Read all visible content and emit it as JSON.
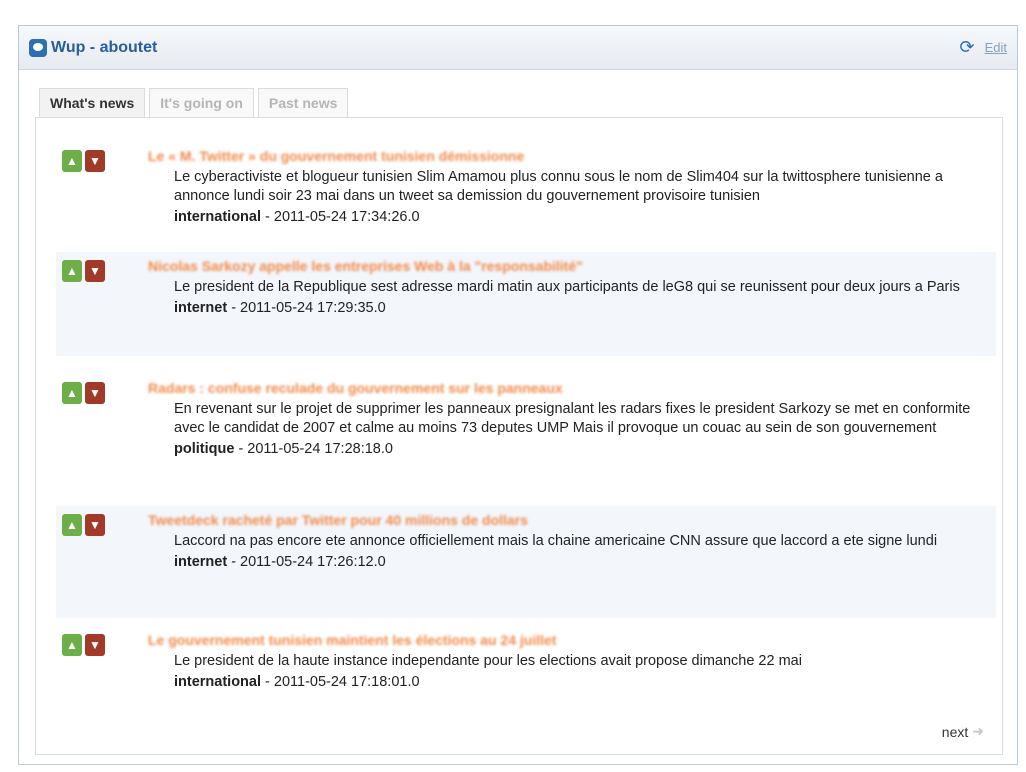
{
  "widget": {
    "title": "Wup - aboutet",
    "edit_label": "Edit"
  },
  "tabs": [
    {
      "label": "What's news"
    },
    {
      "label": "It's going on"
    },
    {
      "label": "Past news"
    }
  ],
  "news": [
    {
      "title": "Le « M. Twitter » du gouvernement tunisien démissionne",
      "body": "Le cyberactiviste et blogueur tunisien Slim Amamou plus connu sous le nom de Slim404 sur la twittosphere tunisienne a annonce lundi soir 23 mai dans un tweet sa demission du gouvernement provisoire tunisien",
      "category": "international",
      "timestamp": " - 2011-05-24 17:34:26.0"
    },
    {
      "title": "Nicolas Sarkozy appelle les entreprises Web à la \"responsabilité\"",
      "body": "Le president de la Republique sest adresse mardi matin aux participants de leG8 qui se reunissent pour deux jours a Paris",
      "category": "internet",
      "timestamp": " - 2011-05-24 17:29:35.0"
    },
    {
      "title": "Radars : confuse reculade du gouvernement sur les panneaux",
      "body": "En revenant sur le projet de supprimer les panneaux presignalant les radars fixes le president Sarkozy se met en conformite avec le candidat de 2007 et calme au moins 73 deputes UMP Mais il provoque un couac au sein de son gouvernement",
      "category": "politique",
      "timestamp": " - 2011-05-24 17:28:18.0"
    },
    {
      "title": "Tweetdeck racheté par Twitter pour 40 millions de dollars",
      "body": "Laccord na pas encore ete annonce officiellement mais la chaine americaine CNN assure que laccord a ete signe lundi",
      "category": "internet",
      "timestamp": " - 2011-05-24 17:26:12.0"
    },
    {
      "title": "Le gouvernement tunisien maintient les élections au 24 juillet",
      "body": "Le president de la haute instance independante pour les elections avait propose dimanche 22 mai",
      "category": "international",
      "timestamp": " - 2011-05-24 17:18:01.0"
    }
  ],
  "pagination": {
    "next_label": "next"
  },
  "icons": {
    "logo": "chat-bubble-icon",
    "refresh": "refresh-icon",
    "vote_up": "thumbs-up-icon",
    "vote_down": "thumbs-down-icon",
    "next": "arrow-right-icon"
  },
  "colors": {
    "title_blue": "#2a5d9e",
    "news_title_orange": "#f08a4b",
    "vote_up_green": "#6dae48",
    "vote_down_red": "#a23a2a"
  }
}
